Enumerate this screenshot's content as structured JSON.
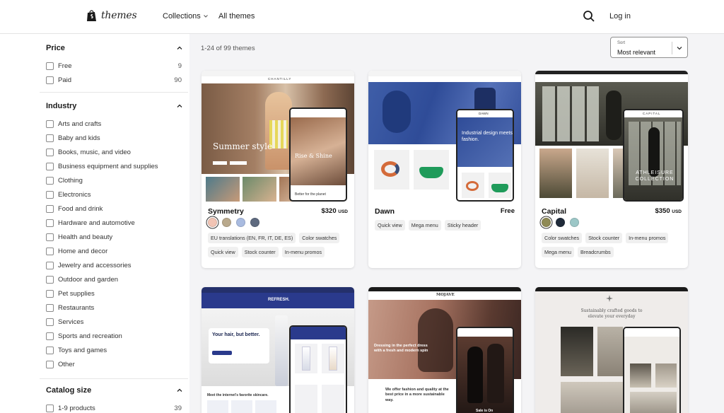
{
  "header": {
    "logo_text": "themes",
    "nav": [
      {
        "label": "Collections"
      },
      {
        "label": "All themes"
      }
    ],
    "login_label": "Log in"
  },
  "sidebar": {
    "price": {
      "title": "Price",
      "options": [
        {
          "label": "Free",
          "count": "9"
        },
        {
          "label": "Paid",
          "count": "90"
        }
      ]
    },
    "industry": {
      "title": "Industry",
      "options": [
        {
          "label": "Arts and crafts"
        },
        {
          "label": "Baby and kids"
        },
        {
          "label": "Books, music, and video"
        },
        {
          "label": "Business equipment and supplies"
        },
        {
          "label": "Clothing"
        },
        {
          "label": "Electronics"
        },
        {
          "label": "Food and drink"
        },
        {
          "label": "Hardware and automotive"
        },
        {
          "label": "Health and beauty"
        },
        {
          "label": "Home and decor"
        },
        {
          "label": "Jewelry and accessories"
        },
        {
          "label": "Outdoor and garden"
        },
        {
          "label": "Pet supplies"
        },
        {
          "label": "Restaurants"
        },
        {
          "label": "Services"
        },
        {
          "label": "Sports and recreation"
        },
        {
          "label": "Toys and games"
        },
        {
          "label": "Other"
        }
      ]
    },
    "catalog_size": {
      "title": "Catalog size",
      "options": [
        {
          "label": "1-9 products",
          "count": "39"
        }
      ]
    }
  },
  "results": {
    "count_text": "1-24 of 99 themes"
  },
  "sort": {
    "label": "Sort",
    "value": "Most relevant"
  },
  "themes": [
    {
      "name": "Symmetry",
      "price": "$320",
      "currency": "USD",
      "swatches": [
        "#f2c4b4",
        "#b9a98c",
        "#a9bbe0",
        "#5e6a7f"
      ],
      "tags": [
        "EU translations (EN, FR, IT, DE, ES)",
        "Color swatches",
        "Quick view",
        "Stock counter",
        "In-menu promos"
      ],
      "preview": {
        "hero": "Summer style",
        "brand": "CHANTILLY",
        "phone_hero": "Rise & Shine",
        "phone_caption": "Better for the planet"
      }
    },
    {
      "name": "Dawn",
      "price": "Free",
      "currency": "",
      "swatches": [],
      "tags": [
        "Quick view",
        "Mega menu",
        "Sticky header"
      ],
      "preview": {
        "brand": "DAWN",
        "hero": "Industrial design meets fashion."
      }
    },
    {
      "name": "Capital",
      "price": "$350",
      "currency": "USD",
      "swatches": [
        "#8f8a55",
        "#1f2a3a",
        "#9cc7c7"
      ],
      "tags": [
        "Color swatches",
        "Stock counter",
        "In-menu promos",
        "Mega menu",
        "Breadcrumbs"
      ],
      "preview": {
        "brand": "CAPITAL",
        "hero": "ATHLEISURE COLLECTION"
      }
    },
    {
      "name": "",
      "preview": {
        "brand": "REFRESH.",
        "hero": "Your hair, but better.",
        "sub": "Meet the internet's favorite skincare."
      }
    },
    {
      "name": "",
      "preview": {
        "brand": "MOJAVE",
        "hero": "Dressing in the perfect dress with a fresh and modern spin",
        "sub": "We offer fashion and quality at the best price in a more sustainable way.",
        "badge": "Sale is On"
      }
    },
    {
      "name": "",
      "preview": {
        "hero": "Sustainably crafted goods to elevate your everyday"
      }
    }
  ],
  "colors": {
    "main_bg": "#f4f4f6",
    "text": "#1a1a1a",
    "border": "#e4e4e4"
  }
}
